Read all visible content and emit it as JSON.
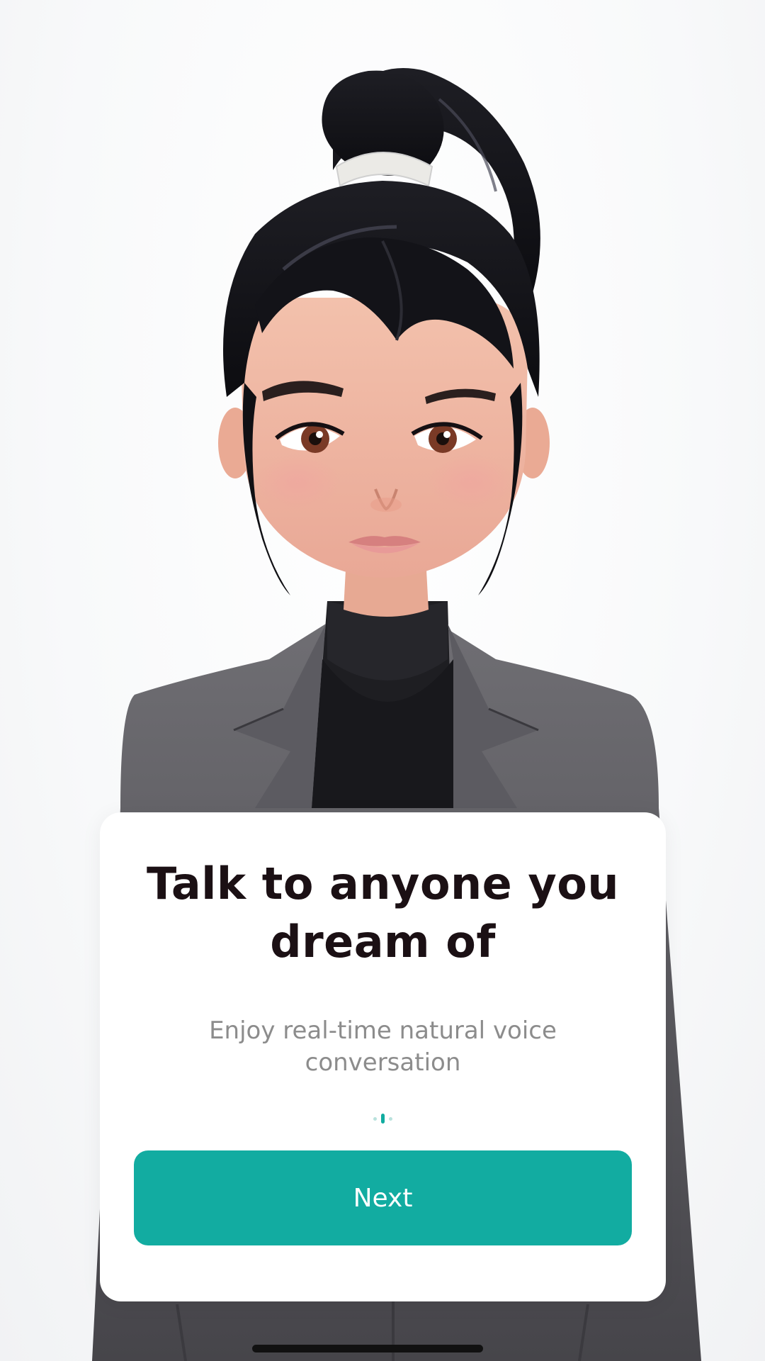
{
  "onboarding": {
    "headline_line1": "Talk to anyone you",
    "headline_line2": "dream of",
    "subtitle_line1": "Enjoy real-time natural voice",
    "subtitle_line2": "conversation",
    "next_label": "Next",
    "pager": {
      "total": 3,
      "active_index": 1
    }
  },
  "colors": {
    "accent": "#12aca1",
    "headline": "#1b1014",
    "subtitle": "#8c8c8c",
    "card": "#ffffff"
  },
  "illustration": {
    "subject": "3d-cartoon-woman-avatar",
    "outfit": "grey-blazer-black-turtleneck"
  }
}
